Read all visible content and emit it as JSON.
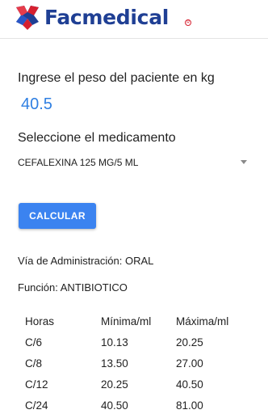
{
  "header": {
    "brand": "Facmedical",
    "reg_mark": "R",
    "logo_icon": "cross-logo-icon",
    "colors": {
      "brand": "#1f3f94",
      "logo_red": "#d6202f",
      "logo_blue": "#1f3f94"
    }
  },
  "form": {
    "weight_label": "Ingrese el peso del paciente en kg",
    "weight_value": "40.5",
    "medicine_label": "Seleccione el medicamento",
    "medicine_selected": "CEFALEXINA 125 MG/5 ML",
    "dropdown_icon": "caret-down-icon",
    "calculate_label": "CALCULAR",
    "colors": {
      "accent": "#3b83f0",
      "input_text": "#2f7fe2"
    }
  },
  "result": {
    "via": "Vía de Administración: ORAL",
    "funcion": "Función: ANTIBIOTICO"
  },
  "dose_table": {
    "headers": [
      "Horas",
      "Mínima/ml",
      "Máxima/ml"
    ],
    "rows": [
      [
        "C/6",
        "10.13",
        "20.25"
      ],
      [
        "C/8",
        "13.50",
        "27.00"
      ],
      [
        "C/12",
        "20.25",
        "40.50"
      ],
      [
        "C/24",
        "40.50",
        "81.00"
      ]
    ]
  }
}
